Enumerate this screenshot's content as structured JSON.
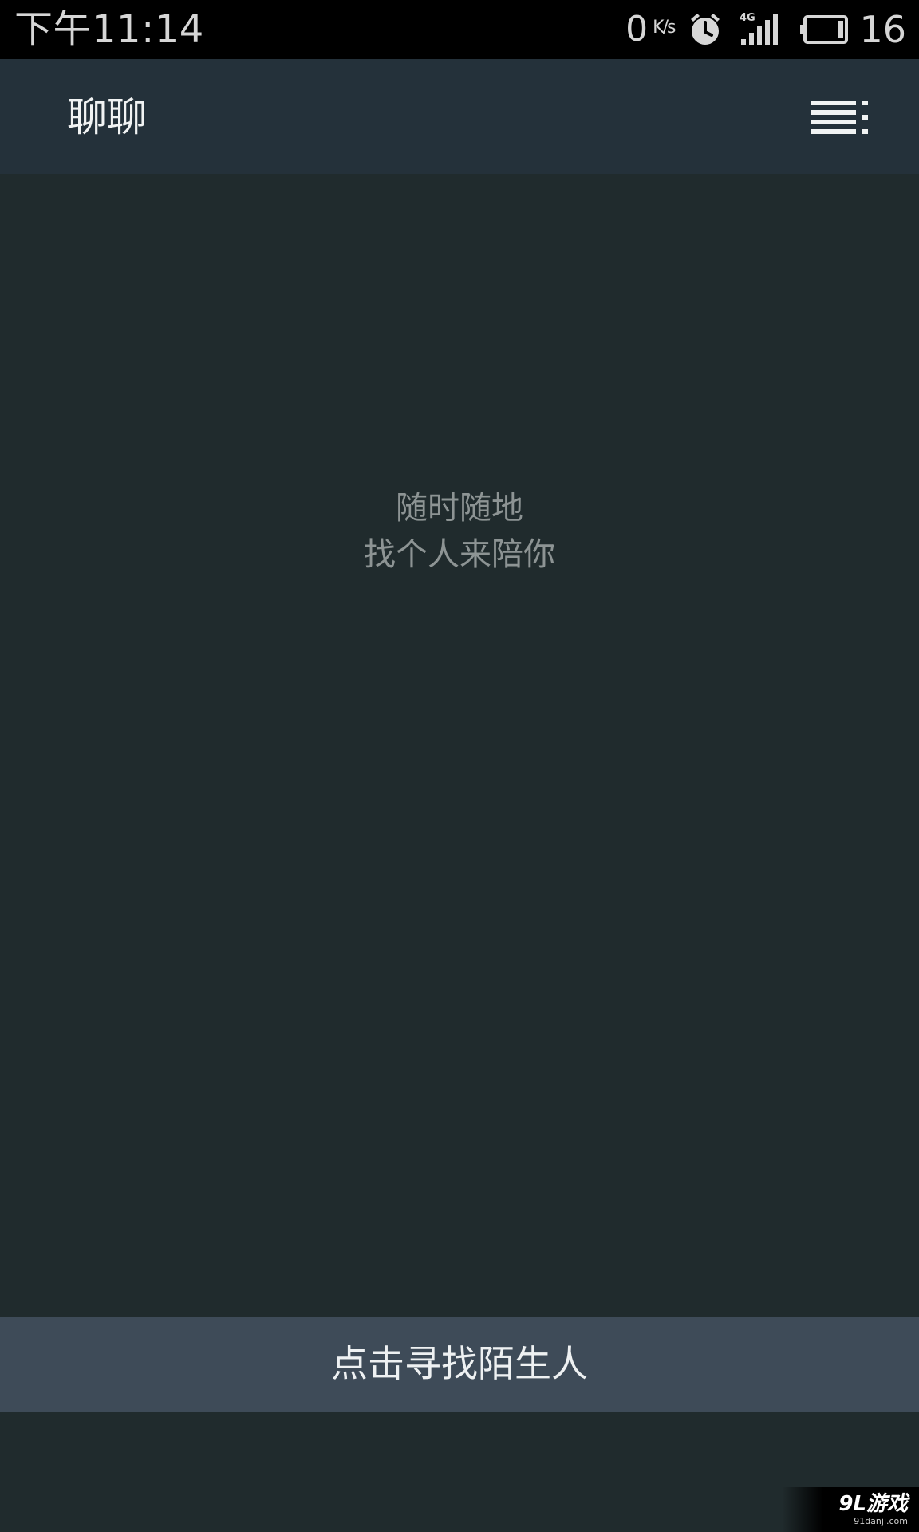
{
  "status_bar": {
    "time": "下午11:14",
    "net_speed_value": "0",
    "net_speed_unit": "K/s",
    "network_label": "4G",
    "battery_level": "16",
    "icons": [
      "alarm-icon",
      "signal-icon",
      "battery-icon"
    ]
  },
  "header": {
    "title": "聊聊",
    "menu_icon": "list-menu-icon"
  },
  "empty_state": {
    "line1": "随时随地",
    "line2": "找个人来陪你"
  },
  "action": {
    "find_stranger_label": "点击寻找陌生人"
  },
  "watermark": {
    "brand": "9L游戏",
    "url": "91danji.com"
  },
  "colors": {
    "background": "#202b2d",
    "app_bar": "#24313a",
    "button": "#3e4b58",
    "status_bar": "#000000"
  }
}
